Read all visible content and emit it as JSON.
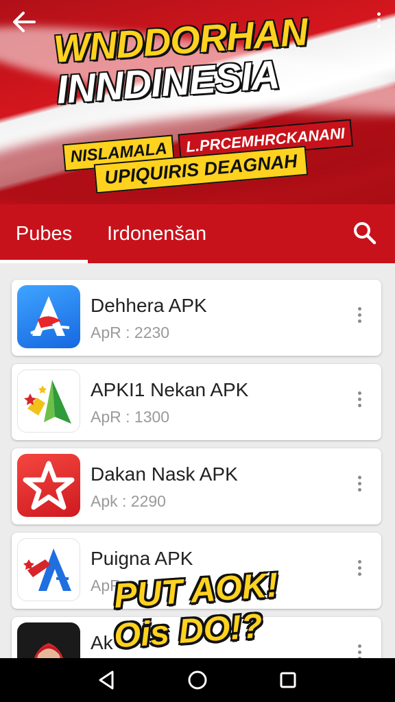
{
  "hero": {
    "title_line1": "WNDDORHAN",
    "title_line2": "INNDINESIA",
    "tag_left": "NISLAMALA",
    "tag_right": "L.PRCEMHRCKANANI",
    "tag_bottom": "UPIQUIRIS DEAGNAH",
    "icons": {
      "back": "arrow-left-icon",
      "more": "more-vertical-icon"
    }
  },
  "tabs": [
    {
      "label": "Pubes",
      "active": true
    },
    {
      "label": "Irdonenšan",
      "active": false
    }
  ],
  "search": {
    "icon": "search-icon"
  },
  "apps": [
    {
      "name": "Dehhera APK",
      "meta": "ApR : 2230",
      "icon": "blue-a-logo-icon"
    },
    {
      "name": "APKI1 Nekan APK",
      "meta": "ApR : 1300",
      "icon": "green-yellow-star-logo-icon"
    },
    {
      "name": "Dakan Nask APK",
      "meta": "Apk : 2290",
      "icon": "red-star-logo-icon"
    },
    {
      "name": "Puigna APK",
      "meta": "ApR",
      "icon": "blue-a-plane-logo-icon"
    },
    {
      "name": "Ak",
      "meta": "",
      "icon": "avatar-woman-hijab-icon"
    }
  ],
  "overlay": {
    "line1": "PUT AOK!",
    "line2": "Ois DO!?"
  },
  "navbar": {
    "icons": [
      "nav-back-icon",
      "nav-home-icon",
      "nav-recent-icon"
    ]
  },
  "colors": {
    "brand_red": "#c8121b",
    "accent_yellow": "#ffd21f"
  }
}
